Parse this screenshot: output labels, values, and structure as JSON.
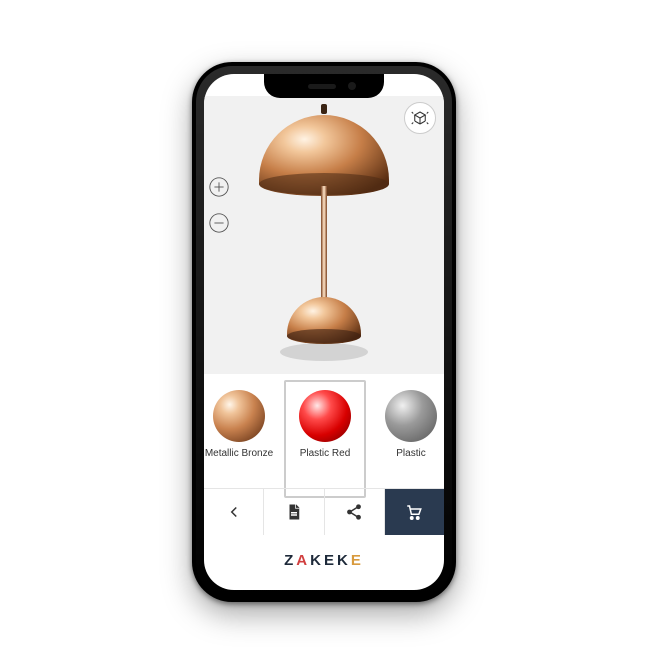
{
  "brand": {
    "letters": [
      "Z",
      "A",
      "K",
      "E",
      "K",
      "E"
    ]
  },
  "viewer": {
    "product": "lamp",
    "material_applied": "Metallic Bronze"
  },
  "controls": {
    "zoom_in": "zoom-in",
    "zoom_out": "zoom-out",
    "ar": "view-in-ar"
  },
  "swatches": [
    {
      "label": "Metallic Bronze",
      "style": "b-bronze",
      "selected": false
    },
    {
      "label": "Plastic Red",
      "style": "b-red",
      "selected": true
    },
    {
      "label": "Plastic Grey",
      "style": "b-grey",
      "selected": false
    }
  ],
  "toolbar": {
    "back": "back",
    "pdf": "pdf",
    "share": "share",
    "cart": "add-to-cart"
  }
}
